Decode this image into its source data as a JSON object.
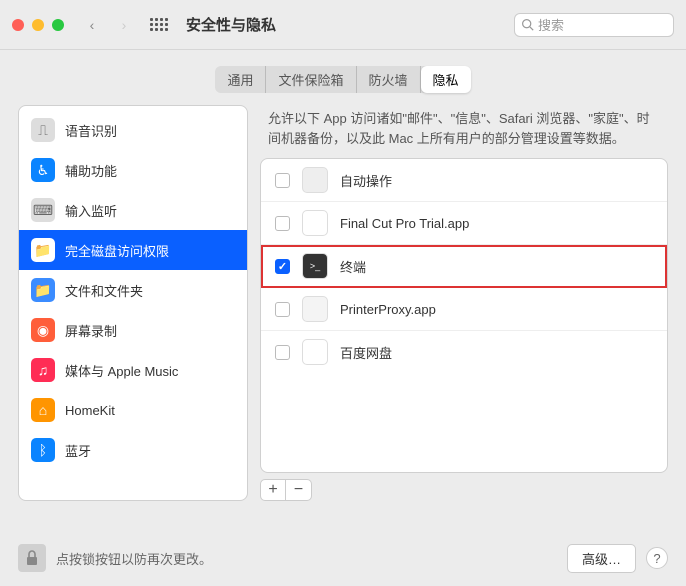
{
  "header": {
    "title": "安全性与隐私",
    "search_placeholder": "搜索"
  },
  "tabs": [
    {
      "label": "通用"
    },
    {
      "label": "文件保险箱"
    },
    {
      "label": "防火墙"
    },
    {
      "label": "隐私"
    }
  ],
  "sidebar": [
    {
      "label": "语音识别",
      "icon_name": "waveform-icon",
      "bg": "#ddd",
      "selected": false
    },
    {
      "label": "辅助功能",
      "icon_name": "accessibility-icon",
      "bg": "#0a84ff",
      "selected": false
    },
    {
      "label": "输入监听",
      "icon_name": "keyboard-icon",
      "bg": "#ddd",
      "selected": false
    },
    {
      "label": "完全磁盘访问权限",
      "icon_name": "folder-icon",
      "bg": "#3b8cff",
      "selected": true
    },
    {
      "label": "文件和文件夹",
      "icon_name": "folder-icon",
      "bg": "#3b8cff",
      "selected": false
    },
    {
      "label": "屏幕录制",
      "icon_name": "record-icon",
      "bg": "#ff5e3a",
      "selected": false
    },
    {
      "label": "媒体与 Apple Music",
      "icon_name": "music-icon",
      "bg": "#ff2d55",
      "selected": false
    },
    {
      "label": "HomeKit",
      "icon_name": "home-icon",
      "bg": "#ff9500",
      "selected": false
    },
    {
      "label": "蓝牙",
      "icon_name": "bluetooth-icon",
      "bg": "#0a84ff",
      "selected": false
    }
  ],
  "description": "允许以下 App 访问诸如\"邮件\"、\"信息\"、Safari 浏览器、\"家庭\"、时间机器备份，以及此 Mac 上所有用户的部分管理设置等数据。",
  "apps": [
    {
      "name": "自动操作",
      "checked": false,
      "highlight": false,
      "icon_bg": "#eee"
    },
    {
      "name": "Final Cut Pro Trial.app",
      "checked": false,
      "highlight": false,
      "icon_bg": "#fff"
    },
    {
      "name": "终端",
      "checked": true,
      "highlight": true,
      "icon_bg": "#333"
    },
    {
      "name": "PrinterProxy.app",
      "checked": false,
      "highlight": false,
      "icon_bg": "#f4f4f4"
    },
    {
      "name": "百度网盘",
      "checked": false,
      "highlight": false,
      "icon_bg": "#fff"
    }
  ],
  "footer": {
    "text": "点按锁按钮以防再次更改。",
    "advanced": "高级…"
  }
}
